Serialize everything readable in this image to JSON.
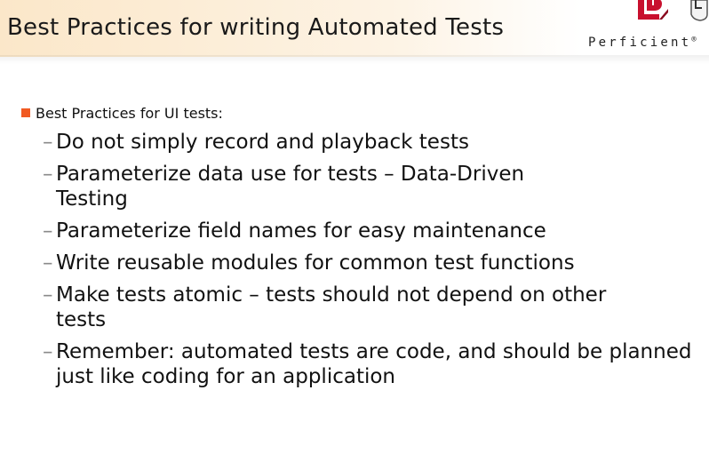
{
  "slide": {
    "title": "Best Practices for writing Automated Tests",
    "logo_text": "Perficient",
    "logo_trademark": "®",
    "main_bullet": "Best Practices for UI tests:",
    "sub_bullets": [
      "Do not simply record and playback tests",
      "Parameterize data use for tests – Data-Driven Testing",
      "Parameterize field names for easy maintenance",
      "Write reusable modules for common test functions",
      "Make tests atomic – tests should not depend on other tests",
      "Remember: automated tests are code, and should be planned just like coding for an application"
    ]
  },
  "colors": {
    "bullet_accent": "#f15a22",
    "logo_red": "#c8102e"
  }
}
